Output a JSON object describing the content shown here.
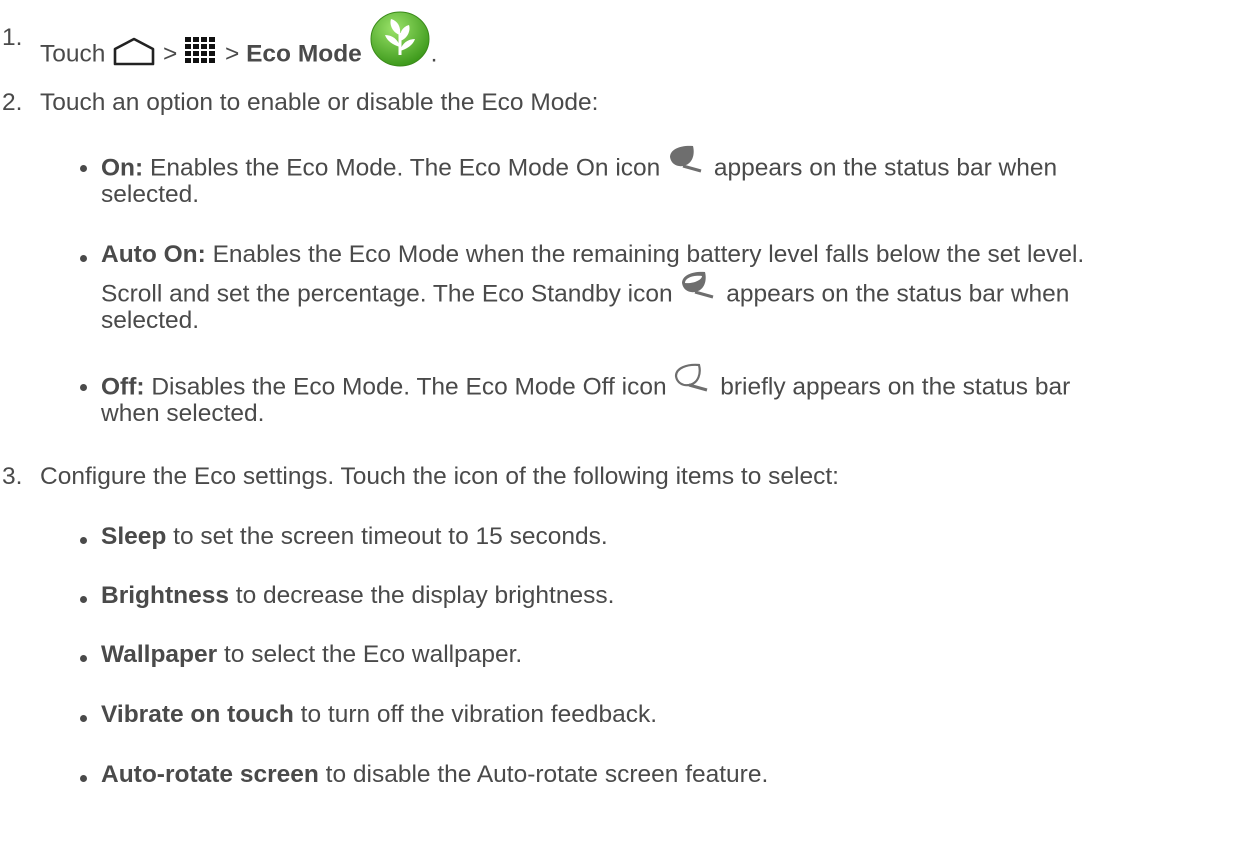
{
  "step1": {
    "number": "1.",
    "touch": "Touch",
    "sep1": ">",
    "sep2": ">",
    "app_name": "Eco Mode",
    "end": ".",
    "icons": [
      "home-icon",
      "apps-grid-icon",
      "eco-mode-app-icon"
    ]
  },
  "step2": {
    "number": "2.",
    "text": "Touch an option to enable or disable the Eco Mode:",
    "options": [
      {
        "label": "On:",
        "text_before": "Enables the Eco Mode. The Eco Mode On icon",
        "text_after": "appears on the status bar when",
        "text_line2": "selected.",
        "icon": "eco-on-leaf-icon"
      },
      {
        "label": "Auto On:",
        "text_line1": "Enables the Eco Mode when the remaining battery level falls below the set level.",
        "text_before": "Scroll and set the percentage. The Eco Standby icon",
        "text_after": "appears on the status bar when",
        "text_line3": "selected.",
        "icon": "eco-standby-leaf-icon"
      },
      {
        "label": "Off:",
        "text_before": "Disables the Eco Mode. The Eco Mode Off icon",
        "text_after": "briefly appears on the status bar",
        "text_line2": "when selected.",
        "icon": "eco-off-leaf-icon"
      }
    ]
  },
  "step3": {
    "number": "3.",
    "text": "Configure the Eco settings. Touch the icon of the following items to select:",
    "items": [
      {
        "label": "Sleep",
        "text": " to set the screen timeout to 15 seconds."
      },
      {
        "label": "Brightness",
        "text": " to decrease the display brightness."
      },
      {
        "label": "Wallpaper",
        "text": " to select the Eco wallpaper."
      },
      {
        "label": "Vibrate on touch",
        "text": " to turn off the vibration feedback."
      },
      {
        "label": "Auto-rotate screen",
        "text": " to disable the Auto-rotate screen feature."
      }
    ]
  },
  "colors": {
    "text": "#4a4a4a",
    "eco_green": "#5cb82e",
    "leaf_gray": "#6e6e6e"
  }
}
